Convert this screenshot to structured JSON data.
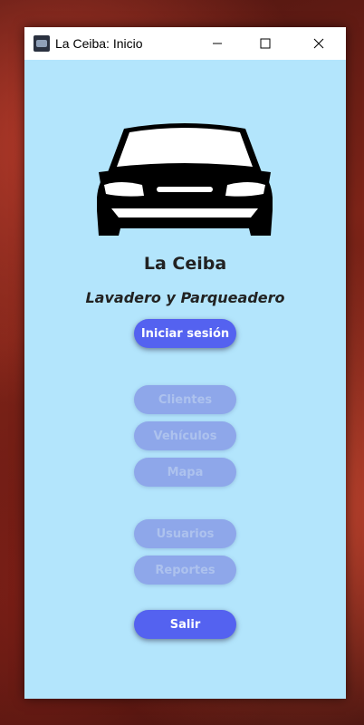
{
  "window": {
    "title": "La Ceiba: Inicio",
    "controls": {
      "minimize": "minimize-icon",
      "maximize": "maximize-icon",
      "close": "close-icon"
    }
  },
  "app": {
    "logo": "car-front-icon",
    "name": "La Ceiba",
    "tagline": "Lavadero y Parqueadero"
  },
  "buttons": {
    "login": "Iniciar sesión",
    "clients": "Clientes",
    "vehicles": "Vehículos",
    "map": "Mapa",
    "users": "Usuarios",
    "reports": "Reportes",
    "exit": "Salir"
  },
  "colors": {
    "window_bg": "#b3e5fc",
    "button_active": "#5462f0",
    "button_disabled": "#8ea7ea"
  }
}
